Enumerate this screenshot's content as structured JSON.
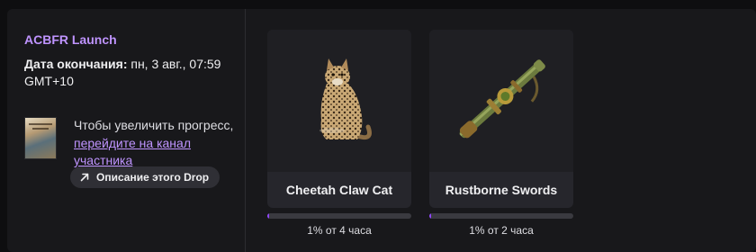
{
  "campaign": {
    "title": "ACBFR Launch",
    "end_date_label": "Дата окончания:",
    "end_date_value": " пн, 3 авг., 07:59 GMT+10"
  },
  "progress_hint": {
    "text_before": "Чтобы увеличить прогресс, ",
    "link_text": "перейдите на канал участника",
    "description_button": "Описание этого Drop",
    "description_icon": "arrow-up-right-icon",
    "game_cover_icon": "game-cover-image"
  },
  "rewards": [
    {
      "name": "Cheetah Claw Cat",
      "image": "cheetah-cat-image",
      "progress_fraction": 0.01,
      "progress_text": "1% от 4 часа"
    },
    {
      "name": "Rustborne Swords",
      "image": "rustborne-swords-image",
      "progress_fraction": 0.01,
      "progress_text": "1% от 2 часа"
    }
  ],
  "colors": {
    "accent": "#bf94ff",
    "progress": "#9147ff",
    "background": "#18181b"
  }
}
